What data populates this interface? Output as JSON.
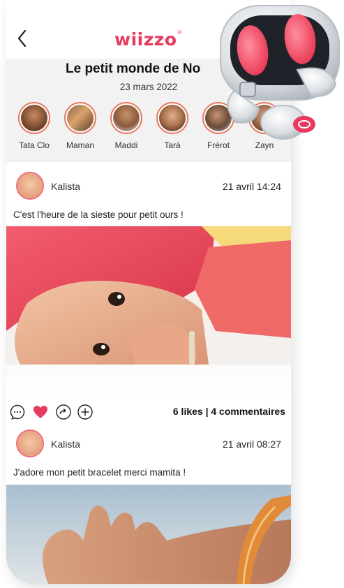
{
  "app": {
    "logo": "wiizzo",
    "logo_mark": "®",
    "brand_color": "#e63b5e"
  },
  "nav": {
    "back_icon": "chevron-left-icon"
  },
  "header": {
    "title": "Le petit monde de No",
    "date": "23 mars 2022"
  },
  "stories": [
    {
      "label": "Tata Clo"
    },
    {
      "label": "Maman"
    },
    {
      "label": "Maddi"
    },
    {
      "label": "Tarà"
    },
    {
      "label": "Frérot"
    },
    {
      "label": "Zayn"
    }
  ],
  "posts": [
    {
      "author": "Kalista",
      "time": "21 avril 14:24",
      "text": "C'est l'heure de la sieste pour petit ours !",
      "likes_summary": "6 likes | 4 commentaires",
      "liked": true
    },
    {
      "author": "Kalista",
      "time": "21 avril 08:27",
      "text": "J'adore mon petit bracelet merci mamita !"
    }
  ],
  "actions": {
    "comment_icon": "comment-icon",
    "like_icon": "heart-icon",
    "share_icon": "share-icon",
    "add_icon": "plus-icon"
  }
}
